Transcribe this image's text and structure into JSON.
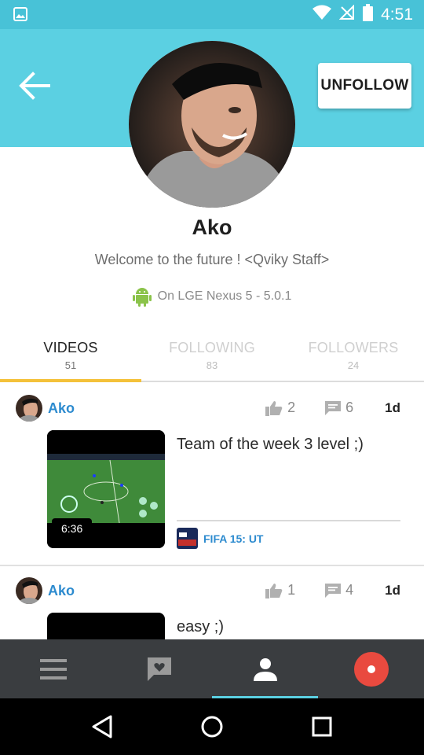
{
  "status_bar": {
    "time": "4:51",
    "icons": [
      "image-icon",
      "wifi-icon",
      "no-signal-icon",
      "battery-icon"
    ]
  },
  "header": {
    "back_icon": "back-arrow-icon",
    "unfollow_label": "UNFOLLOW",
    "color": "#5bd0e2"
  },
  "profile": {
    "name": "Ako",
    "bio": "Welcome to the future ! <Qviky Staff>",
    "device": "On LGE Nexus 5 - 5.0.1",
    "device_icon": "android-icon"
  },
  "tabs": [
    {
      "label": "VIDEOS",
      "count": "51",
      "active": true
    },
    {
      "label": "FOLLOWING",
      "count": "83",
      "active": false
    },
    {
      "label": "FOLLOWERS",
      "count": "24",
      "active": false
    }
  ],
  "posts": [
    {
      "user": "Ako",
      "likes": "2",
      "comments": "6",
      "time": "1d",
      "title": "Team of the week 3 level ;)",
      "duration": "6:36",
      "game": "FIFA 15: UT"
    },
    {
      "user": "Ako",
      "likes": "1",
      "comments": "4",
      "time": "1d",
      "title": "easy ;)"
    }
  ],
  "bottom_nav": [
    "menu-icon",
    "chat-icon",
    "profile-icon",
    "record-icon"
  ],
  "system_nav": [
    "back-triangle-icon",
    "home-circle-icon",
    "recents-square-icon"
  ],
  "colors": {
    "accent": "#5bd0e2",
    "tab_indicator": "#f4c13a",
    "link": "#2d8bcf",
    "record": "#e94a3f",
    "nav_bg": "#3a3d40"
  }
}
